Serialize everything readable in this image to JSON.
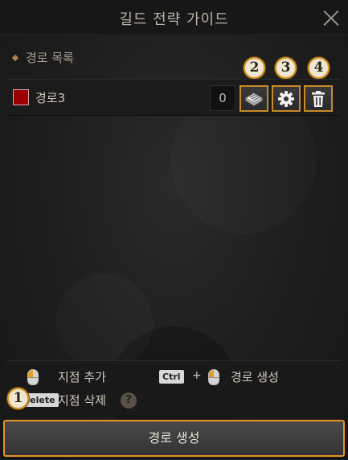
{
  "window": {
    "title": "길드 전략 가이드"
  },
  "section": {
    "title": "경로 목록"
  },
  "routes": [
    {
      "name": "경로3",
      "color": "#9a0000",
      "count": "0"
    }
  ],
  "markers": {
    "m1": "1",
    "m2": "2",
    "m3": "3",
    "m4": "4"
  },
  "icons": {
    "close": "close-icon",
    "map": "map-icon",
    "settings": "gear-icon",
    "delete": "trash-icon"
  },
  "help": {
    "add_point": "지점 추가",
    "ctrl_key": "Ctrl",
    "plus": "+",
    "create_route": "경로 생성",
    "delete_key": "Delete",
    "delete_point": "지점 삭제",
    "help_symbol": "?"
  },
  "footer": {
    "create_button": "경로 생성"
  },
  "colors": {
    "accent": "#e39424",
    "route_color": "#9a0000"
  }
}
